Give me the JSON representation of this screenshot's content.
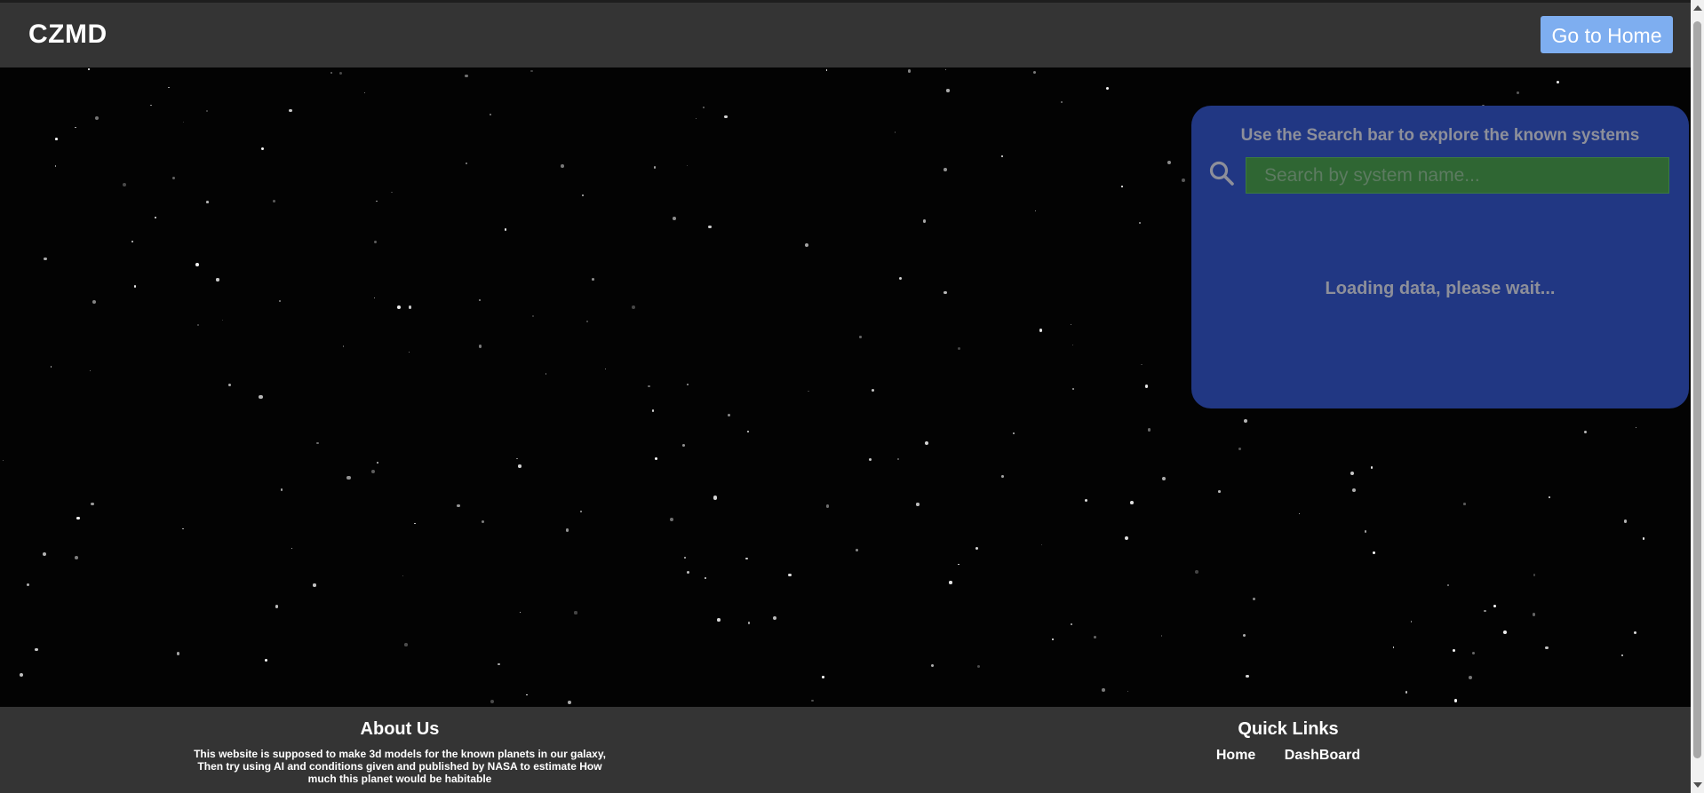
{
  "header": {
    "brand": "CZMD",
    "home_button_label": "Go to Home"
  },
  "search_panel": {
    "title": "Use the Search bar to explore the known systems",
    "search_placeholder": "Search by system name...",
    "loading_text": "Loading data, please wait...",
    "search_icon": "search-icon"
  },
  "footer": {
    "about": {
      "heading": "About Us",
      "text": "This website is supposed to make 3d models for the known planets in our galaxy, Then try using AI and conditions given and published by NASA to estimate How much this planet would be habitable"
    },
    "quick_links": {
      "heading": "Quick Links",
      "items": [
        {
          "label": "Home"
        },
        {
          "label": "DashBoard"
        }
      ]
    }
  },
  "colors": {
    "header_bg": "#343434",
    "panel_bg": "#213783",
    "search_bg": "#2f6633",
    "button_bg": "#7eaef0"
  }
}
